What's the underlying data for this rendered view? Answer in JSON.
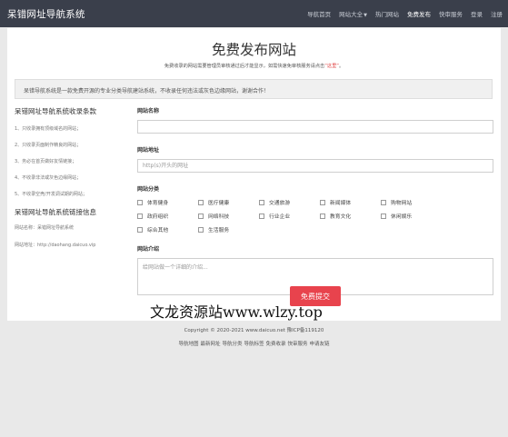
{
  "header": {
    "brand": "呆错网址导航系统",
    "nav": [
      {
        "label": "导航首页",
        "active": false,
        "caret": false
      },
      {
        "label": "网站大全",
        "active": false,
        "caret": true
      },
      {
        "label": "热门网站",
        "active": false,
        "caret": false
      },
      {
        "label": "免费发布",
        "active": true,
        "caret": false
      },
      {
        "label": "快审服务",
        "active": false,
        "caret": false
      },
      {
        "label": "登录",
        "active": false,
        "caret": false
      },
      {
        "label": "注册",
        "active": false,
        "caret": false
      }
    ]
  },
  "page": {
    "title": "免费发布网站",
    "subtitle_pre": "免费收录的网站需要管理员审核通过后才能显示，如需快速免审核服务请点击",
    "subtitle_link": "“这里”",
    "subtitle_post": "。",
    "notice": "呆错导航系统是一款免费开源的专业分类导航建站系统，不收录任何违法或灰色边缘网站，谢谢合作！"
  },
  "sidebar": {
    "rules_title": "呆错网址导航系统收录条款",
    "rules": [
      "1、只收录拥有顶级域名的网站；",
      "2、只收录页面制作精良的网站；",
      "3、务必在首页做好友情链接；",
      "4、不收录非法或灰色边缘网站；",
      "5、不收录空壳/开发调试期的网站；"
    ],
    "link_title": "呆错网址导航系统链接信息",
    "info": [
      "网站名称：呆错网址导航系统",
      "网站地址：http://daohang.daicuo.vip"
    ]
  },
  "form": {
    "name_label": "网站名称",
    "name_value": "",
    "url_label": "网站地址",
    "url_placeholder": "http(s)开头的网址",
    "url_value": "",
    "category_label": "网站分类",
    "categories": [
      "体育健身",
      "医疗健康",
      "交通旅游",
      "新闻媒体",
      "购物网站",
      "政府组织",
      "网络科技",
      "行业企业",
      "教育文化",
      "休闲娱乐",
      "综合其他",
      "生活服务"
    ],
    "intro_label": "网站介绍",
    "intro_placeholder": "给网站做一个详细的介绍...",
    "intro_value": "",
    "submit_label": "免费提交"
  },
  "footer": {
    "copyright": "Copyright © 2020-2021 www.daicuo.net 豫ICP备119120",
    "links": [
      "导航地图",
      "最新网址",
      "导航分类",
      "导航标签",
      "免费收录",
      "快审服务",
      "申请友链"
    ]
  },
  "watermark": "文龙资源站www.wlzy.top",
  "colors": {
    "topbar": "#3a3f4b",
    "submit": "#e8434d",
    "subtitle_link": "#e04040"
  }
}
